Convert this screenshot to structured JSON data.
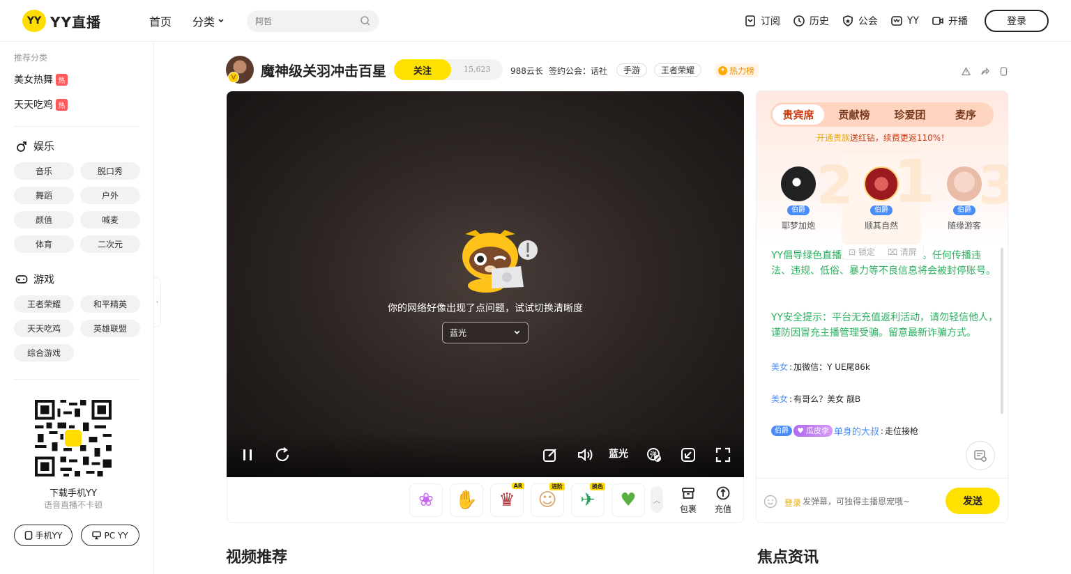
{
  "header": {
    "logo_badge": "YY",
    "logo_text": "YY直播",
    "nav": [
      "首页",
      "分类"
    ],
    "search_placeholder": "阿哲",
    "right": [
      "订阅",
      "历史",
      "公会",
      "YY",
      "开播"
    ],
    "login": "登录"
  },
  "sidebar": {
    "recommend_label": "推荐分类",
    "hot_items": [
      {
        "label": "美女热舞",
        "tag": "热"
      },
      {
        "label": "天天吃鸡",
        "tag": "热"
      }
    ],
    "entertainment": {
      "title": "娱乐",
      "chips": [
        "音乐",
        "脱口秀",
        "舞蹈",
        "户外",
        "颜值",
        "喊麦",
        "体育",
        "二次元"
      ]
    },
    "games": {
      "title": "游戏",
      "chips": [
        "王者荣耀",
        "和平精英",
        "天天吃鸡",
        "英雄联盟",
        "综合游戏"
      ]
    },
    "qr_title": "下载手机YY",
    "qr_sub": "语音直播不卡顿",
    "download": [
      "手机YY",
      "PC YY"
    ]
  },
  "room": {
    "title": "魔神级关羽冲击百星",
    "follow": "关注",
    "follow_count": "15,623",
    "yunzhang": "988云长",
    "guild": "签约公会：话社",
    "tags": [
      "手游",
      "王者荣耀"
    ],
    "hot_rank": "热力榜"
  },
  "video": {
    "error_msg": "你的网络好像出现了点问题，试试切换清晰度",
    "quality": "蓝光",
    "quality_ctrl": "蓝光"
  },
  "gifts": {
    "badges": [
      "AR",
      "进阶",
      "换色"
    ],
    "bag": "包裹",
    "recharge": "充值"
  },
  "panel": {
    "tabs": [
      "贵宾席",
      "贡献榜",
      "珍爱团",
      "麦序"
    ],
    "promo_prefix": "开通贵族",
    "promo_rest": "送红钻，续费更返110%！",
    "rank_users": [
      {
        "name": "耶梦加炮",
        "badge": "伯爵"
      },
      {
        "name": "顺其自然",
        "badge": "伯爵"
      },
      {
        "name": "随缘游客",
        "badge": "伯爵"
      }
    ],
    "chat_tools": [
      "锁定",
      "清屏"
    ],
    "notice1": "YY倡导绿色直播，24小时在线巡查。任何传播违法、违规、低俗、暴力等不良信息将会被封停账号。",
    "notice2": "YY安全提示：平台无充值返利活动，请勿轻信他人，谨防因冒充主播管理受骗。留意最新诈骗方式。",
    "messages": [
      {
        "user": "美女",
        "text": "加微信：Y UE尾86k"
      },
      {
        "user": "美女",
        "text": "有哥么？美女 靓B"
      }
    ],
    "last_msg": {
      "badge": "伯爵",
      "fan": "瓜皮李",
      "user": "单身的大叔",
      "text": "走位接枪"
    },
    "input_login": "登录",
    "input_placeholder": "发弹幕，可独得主播恩宠哦~",
    "send": "发送"
  },
  "sections": [
    "视频推荐",
    "焦点资讯"
  ],
  "colors": {
    "brand": "#ffdd00",
    "accent_green": "#2bb060",
    "user_blue": "#4a8cf5"
  }
}
